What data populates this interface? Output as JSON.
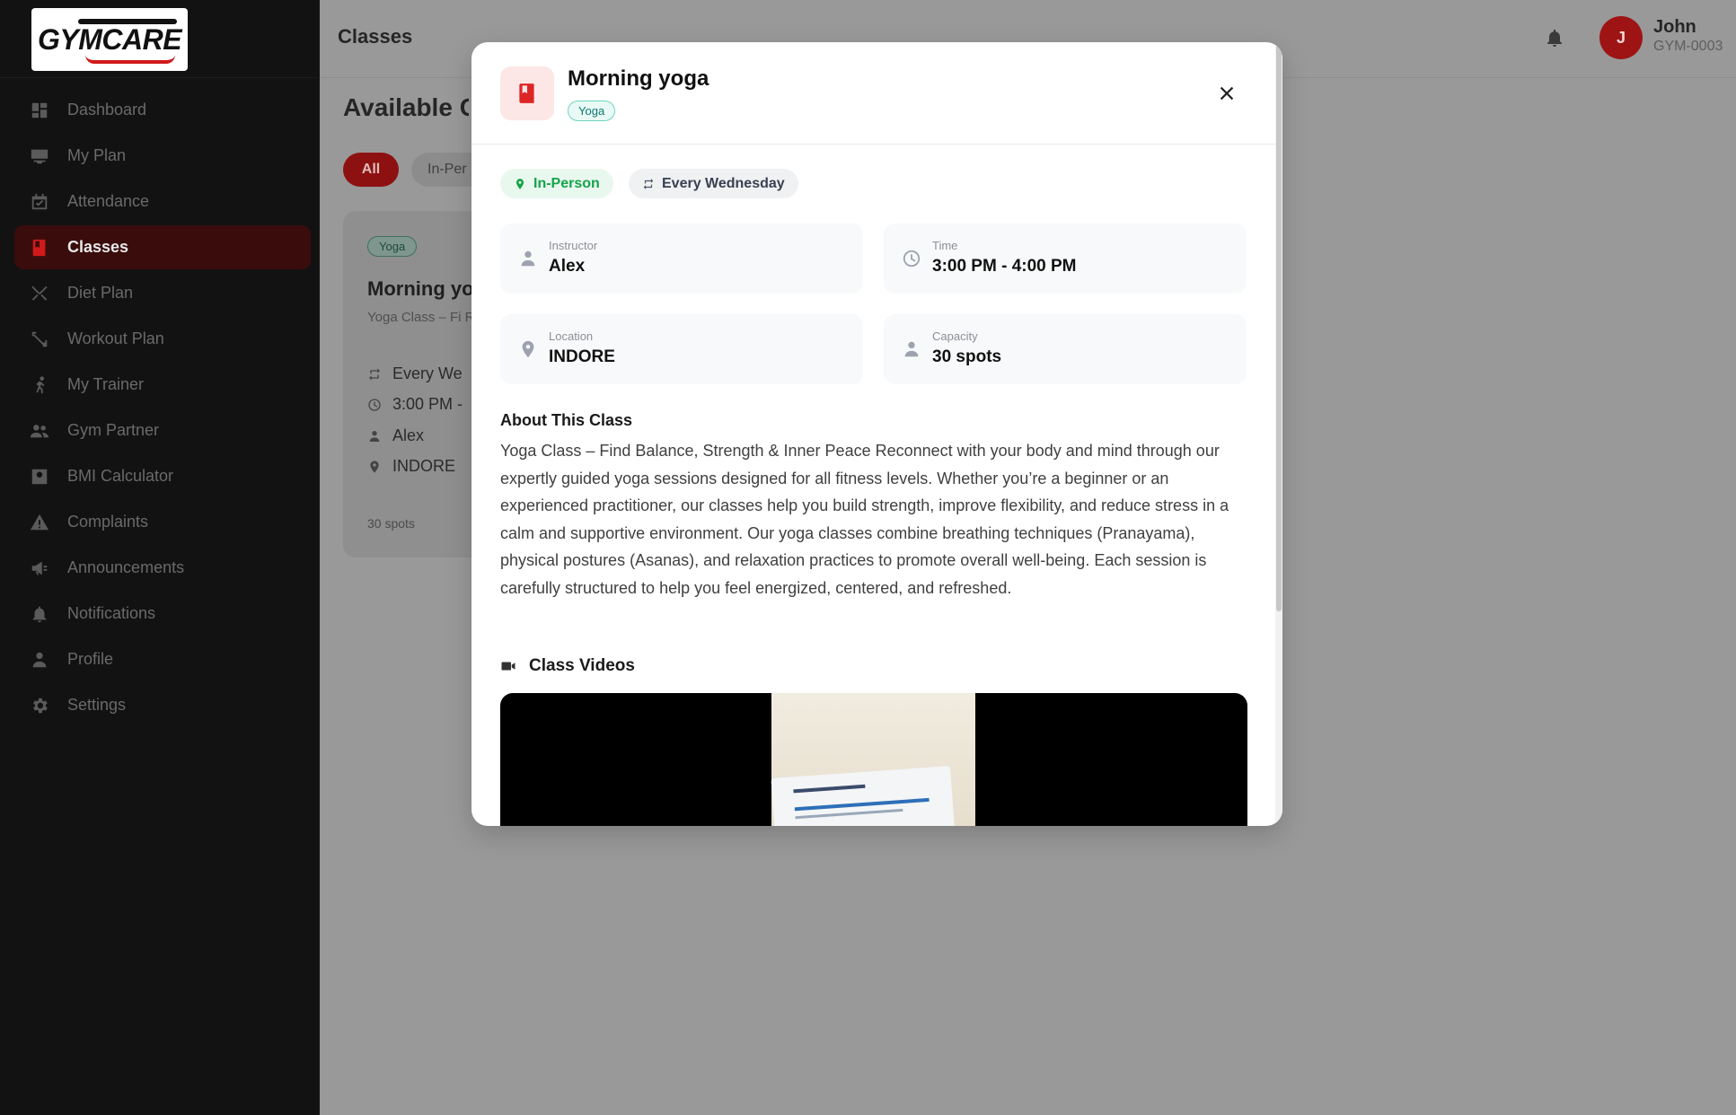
{
  "brand": {
    "logo_text": "GYMCARE"
  },
  "sidebar": {
    "items": [
      {
        "label": "Dashboard",
        "icon": "dashboard-icon"
      },
      {
        "label": "My Plan",
        "icon": "plan-icon"
      },
      {
        "label": "Attendance",
        "icon": "calendar-check-icon"
      },
      {
        "label": "Classes",
        "icon": "book-icon",
        "active": true
      },
      {
        "label": "Diet Plan",
        "icon": "utensils-icon"
      },
      {
        "label": "Workout Plan",
        "icon": "dumbbell-icon"
      },
      {
        "label": "My Trainer",
        "icon": "trainer-icon"
      },
      {
        "label": "Gym Partner",
        "icon": "people-icon"
      },
      {
        "label": "BMI Calculator",
        "icon": "calculator-icon"
      },
      {
        "label": "Complaints",
        "icon": "warning-icon"
      },
      {
        "label": "Announcements",
        "icon": "megaphone-icon"
      },
      {
        "label": "Notifications",
        "icon": "bell-icon"
      },
      {
        "label": "Profile",
        "icon": "person-icon"
      },
      {
        "label": "Settings",
        "icon": "gear-icon"
      }
    ]
  },
  "header": {
    "title": "Classes",
    "user": {
      "initial": "J",
      "name": "John",
      "id": "GYM-0003"
    }
  },
  "page": {
    "title": "Available C",
    "filters": {
      "all": "All",
      "in_person": "In-Per"
    },
    "card": {
      "tag": "Yoga",
      "name": "Morning yo",
      "desc": "Yoga Class – Fi Reconnect with",
      "schedule": "Every We",
      "time": "3:00 PM -",
      "instructor": "Alex",
      "location": "INDORE",
      "spots": "30 spots"
    }
  },
  "modal": {
    "title": "Morning yoga",
    "tag": "Yoga",
    "chips": {
      "mode": "In-Person",
      "schedule": "Every Wednesday"
    },
    "info": {
      "instructor": {
        "label": "Instructor",
        "value": "Alex"
      },
      "time": {
        "label": "Time",
        "value": "3:00 PM - 4:00 PM"
      },
      "location": {
        "label": "Location",
        "value": "INDORE"
      },
      "capacity": {
        "label": "Capacity",
        "value": "30 spots"
      }
    },
    "about": {
      "heading": "About This Class",
      "text": "Yoga Class – Find Balance, Strength & Inner Peace Reconnect with your body and mind through our expertly guided yoga sessions designed for all fitness levels. Whether you’re a beginner or an experienced practitioner, our classes help you build strength, improve flexibility, and reduce stress in a calm and supportive environment. Our yoga classes combine breathing techniques (Pranayama), physical postures (Asanas), and relaxation practices to promote overall well-being. Each session is carefully structured to help you feel energized, centered, and refreshed."
    },
    "videos": {
      "heading": "Class Videos"
    }
  },
  "colors": {
    "accent": "#dc2626",
    "success": "#16a34a",
    "teal": "#0f766e"
  }
}
